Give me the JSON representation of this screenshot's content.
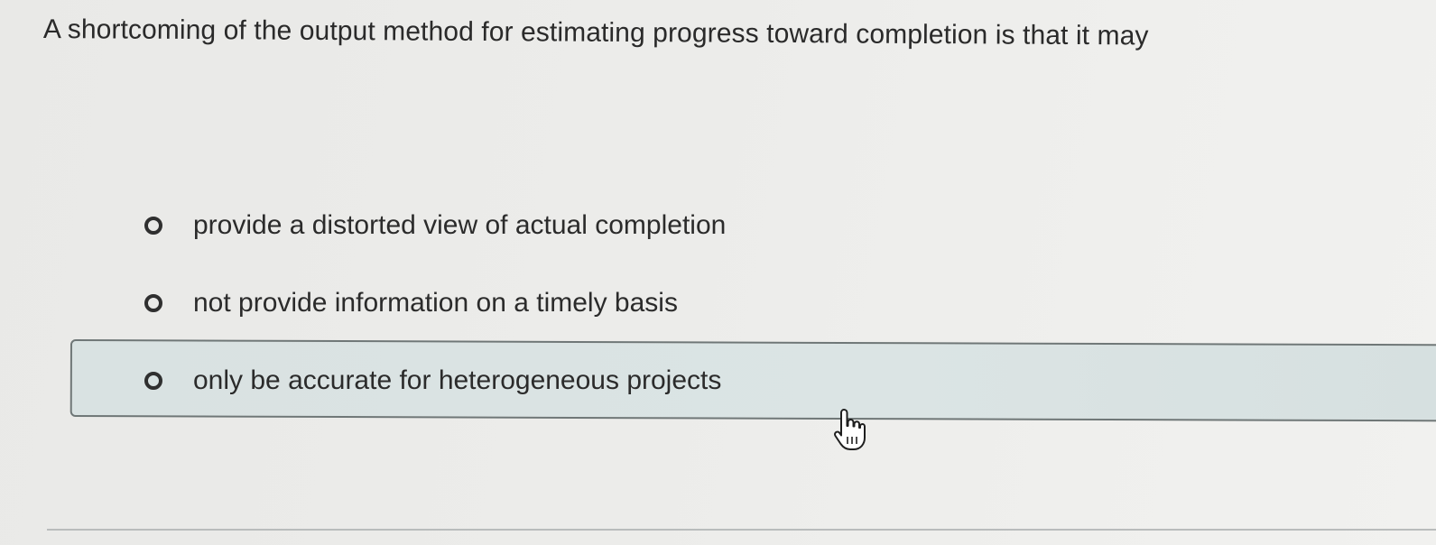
{
  "question": {
    "text": "A shortcoming of the output method for estimating progress toward completion is that it may"
  },
  "options": [
    {
      "label": "provide a distorted view of actual completion",
      "selected": false,
      "highlighted": false
    },
    {
      "label": "not provide information on a timely basis",
      "selected": false,
      "highlighted": false
    },
    {
      "label": "only be accurate for heterogeneous projects",
      "selected": false,
      "highlighted": true
    }
  ],
  "cursor": {
    "icon": "hand-pointer-icon"
  },
  "colors": {
    "background": "#ececea",
    "highlight_fill": "#dbe4e4",
    "highlight_border": "#6f7777",
    "text": "#2b2b2b"
  }
}
